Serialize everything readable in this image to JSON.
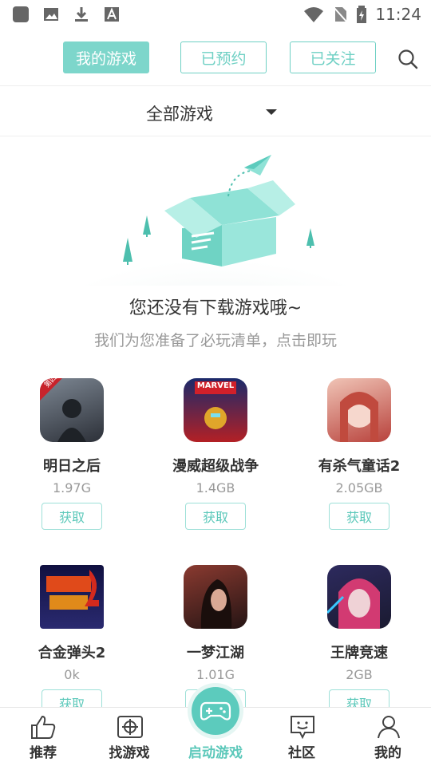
{
  "status_bar": {
    "time": "11:24"
  },
  "top_tabs": [
    {
      "label": "我的游戏",
      "active": true
    },
    {
      "label": "已预约",
      "active": false
    },
    {
      "label": "已关注",
      "active": false
    }
  ],
  "filter": {
    "label": "全部游戏"
  },
  "empty_state": {
    "title": "您还没有下载游戏哦~",
    "subtitle": "我们为您准备了必玩清单，点击即玩"
  },
  "games": [
    {
      "name": "明日之后",
      "size": "1.97G",
      "button": "获取",
      "badge": "第四季",
      "colors": [
        "#5a6470",
        "#2c3038"
      ]
    },
    {
      "name": "漫威超级战争",
      "size": "1.4GB",
      "button": "获取",
      "badge": "MARVEL",
      "colors": [
        "#b32025",
        "#1b2a6b"
      ]
    },
    {
      "name": "有杀气童话2",
      "size": "2.05GB",
      "button": "获取",
      "badge": "",
      "colors": [
        "#e7a39a",
        "#b8423c"
      ]
    },
    {
      "name": "合金弹头2",
      "size": "0k",
      "button": "获取",
      "badge": "",
      "colors": [
        "#1a1a55",
        "#d43a1e"
      ]
    },
    {
      "name": "一梦江湖",
      "size": "1.01G",
      "button": "获取",
      "badge": "",
      "colors": [
        "#7a2a24",
        "#2a1a18"
      ]
    },
    {
      "name": "王牌竞速",
      "size": "2GB",
      "button": "获取",
      "badge": "",
      "colors": [
        "#2d2a5e",
        "#c2366a"
      ]
    }
  ],
  "bottom_nav": [
    {
      "label": "推荐",
      "icon": "thumbs-up-icon",
      "active": false
    },
    {
      "label": "找游戏",
      "icon": "crosshair-icon",
      "active": false
    },
    {
      "label": "启动游戏",
      "icon": "gamepad-icon",
      "active": true
    },
    {
      "label": "社区",
      "icon": "chat-face-icon",
      "active": false
    },
    {
      "label": "我的",
      "icon": "person-icon",
      "active": false
    }
  ],
  "colors": {
    "accent": "#5cc8ba",
    "accent_light": "#7dd6cb"
  }
}
